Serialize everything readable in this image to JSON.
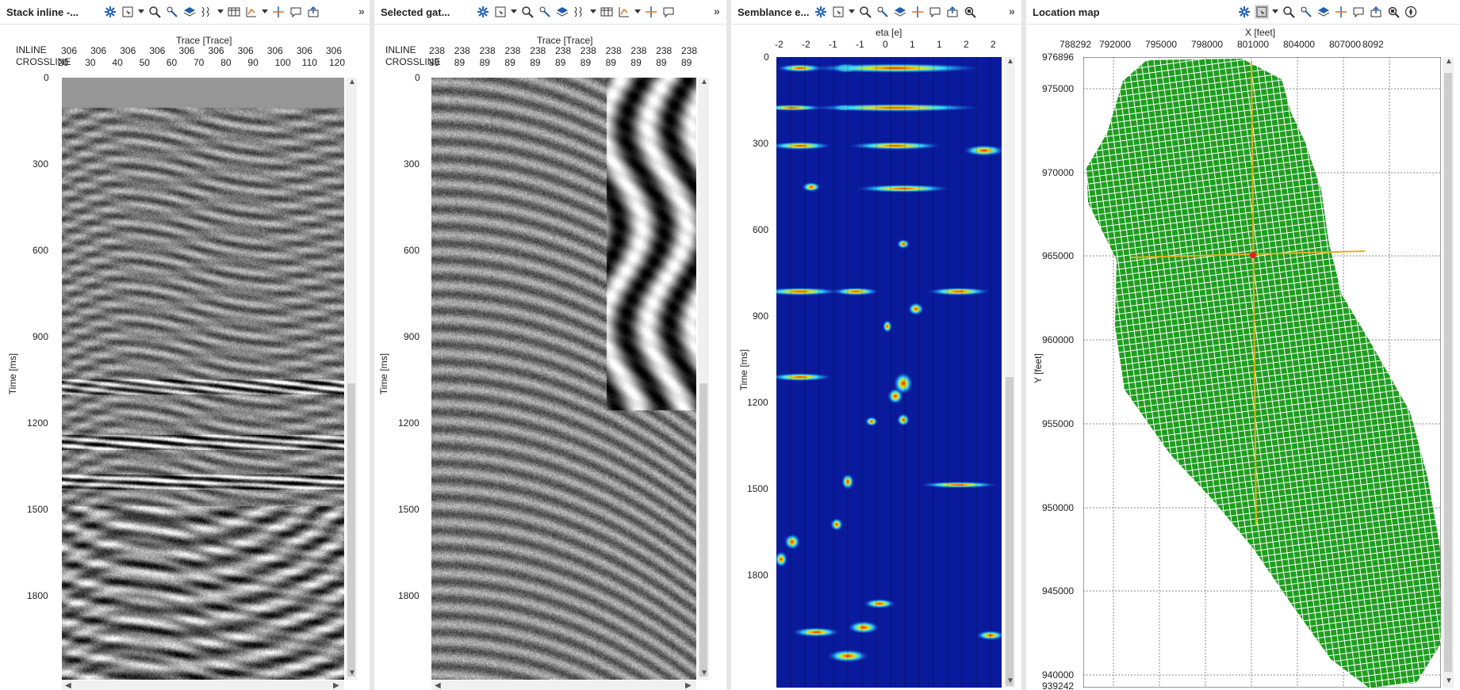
{
  "panels": {
    "stack": {
      "title": "Stack inline -...",
      "xlabel": "Trace [Trace]",
      "row1_name": "INLINE",
      "row2_name": "CROSSLINE",
      "inline_values": [
        "306",
        "306",
        "306",
        "306",
        "306",
        "306",
        "306",
        "306",
        "306",
        "306"
      ],
      "crossline_values": [
        "20",
        "30",
        "40",
        "50",
        "60",
        "70",
        "80",
        "90",
        "100",
        "110",
        "120"
      ],
      "ylabel": "Time [ms]",
      "yticks": [
        "0",
        "300",
        "600",
        "900",
        "1200",
        "1500",
        "1800"
      ]
    },
    "gather": {
      "title": "Selected gat...",
      "xlabel": "Trace [Trace]",
      "row1_name": "INLINE",
      "row2_name": "CROSSLINE",
      "inline_values": [
        "238",
        "238",
        "238",
        "238",
        "238",
        "238",
        "238",
        "238",
        "238",
        "238",
        "238"
      ],
      "crossline_values": [
        "89",
        "89",
        "89",
        "89",
        "89",
        "89",
        "89",
        "89",
        "89",
        "89",
        "89"
      ],
      "ylabel": "Time [ms]",
      "yticks": [
        "0",
        "300",
        "600",
        "900",
        "1200",
        "1500",
        "1800"
      ]
    },
    "semblance": {
      "title": "Semblance e...",
      "xlabel": "eta [e]",
      "xticks": [
        "-2",
        "-2",
        "-1",
        "-1",
        "0",
        "1",
        "1",
        "2",
        "2"
      ],
      "ylabel": "Time [ms]",
      "yticks": [
        "0",
        "300",
        "600",
        "900",
        "1200",
        "1500",
        "1800"
      ]
    },
    "map": {
      "title": "Location map",
      "xlabel": "X [feet]",
      "ylabel": "Y [feet]",
      "xticks": [
        "788292",
        "792000",
        "795000",
        "798000",
        "801000",
        "804000",
        "807000",
        "8092"
      ],
      "yticks": [
        "976896",
        "975000",
        "970000",
        "965000",
        "960000",
        "955000",
        "950000",
        "945000",
        "940000",
        "939242"
      ],
      "footprint_color": "#1e9e1e",
      "crosshair_color": "#e0b020",
      "marker_color": "#e02020"
    }
  },
  "colors": {
    "toolbar_blue": "#1f5fb0",
    "semblance_low": "#0a1a9c",
    "semblance_high": "#e01010"
  }
}
